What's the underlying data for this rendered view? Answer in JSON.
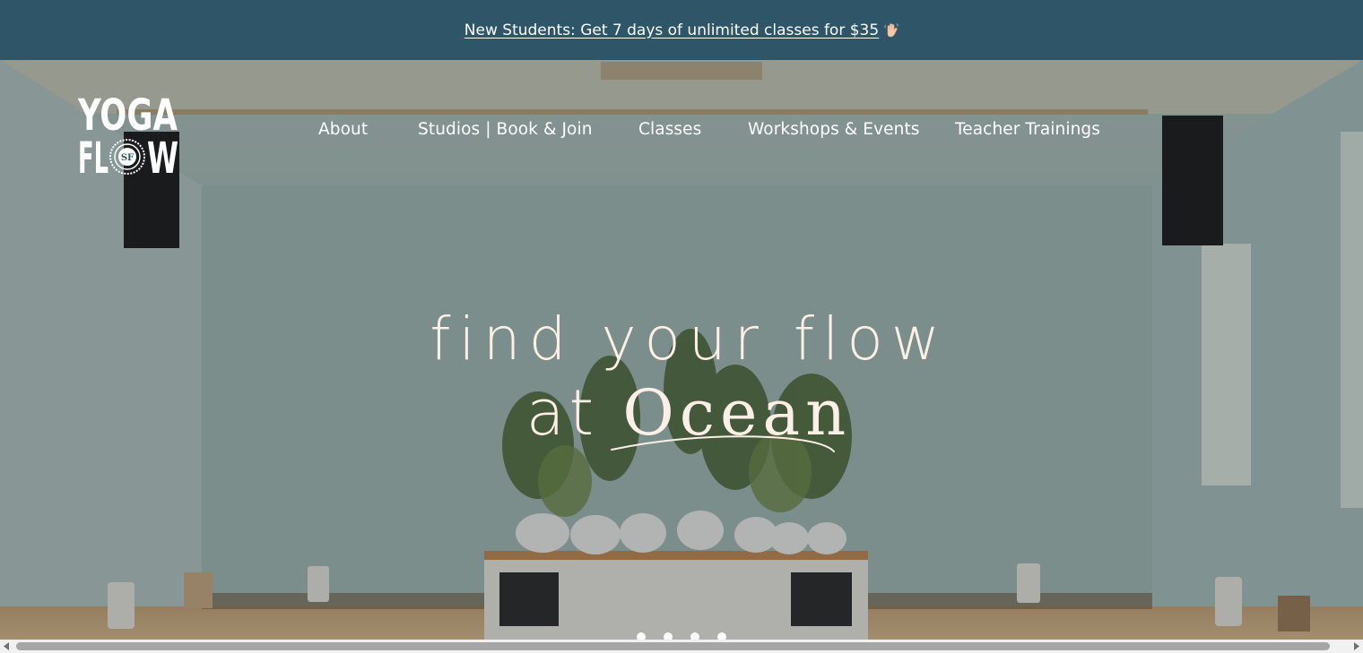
{
  "announcement": {
    "text": "New Students: Get 7 days of unlimited classes for $35",
    "icon": "waving-hand-icon"
  },
  "logo": {
    "line1": "YOGA",
    "line2_left": "FL",
    "line2_right": "W",
    "seal": "SF"
  },
  "nav": {
    "items": [
      {
        "label": "About"
      },
      {
        "label": "Studios | Book & Join"
      },
      {
        "label": "Classes"
      },
      {
        "label": "Workshops & Events"
      },
      {
        "label": "Teacher Trainings"
      }
    ]
  },
  "hero": {
    "headline_line1": "find your flow",
    "headline_line2_prefix": "at",
    "headline_line2_location": "Ocean",
    "slide_count": 4
  },
  "colors": {
    "announcement_bg": "#2e5668",
    "headline_text": "#fbefe6",
    "scroll_thumb": "#a6a6a6"
  }
}
